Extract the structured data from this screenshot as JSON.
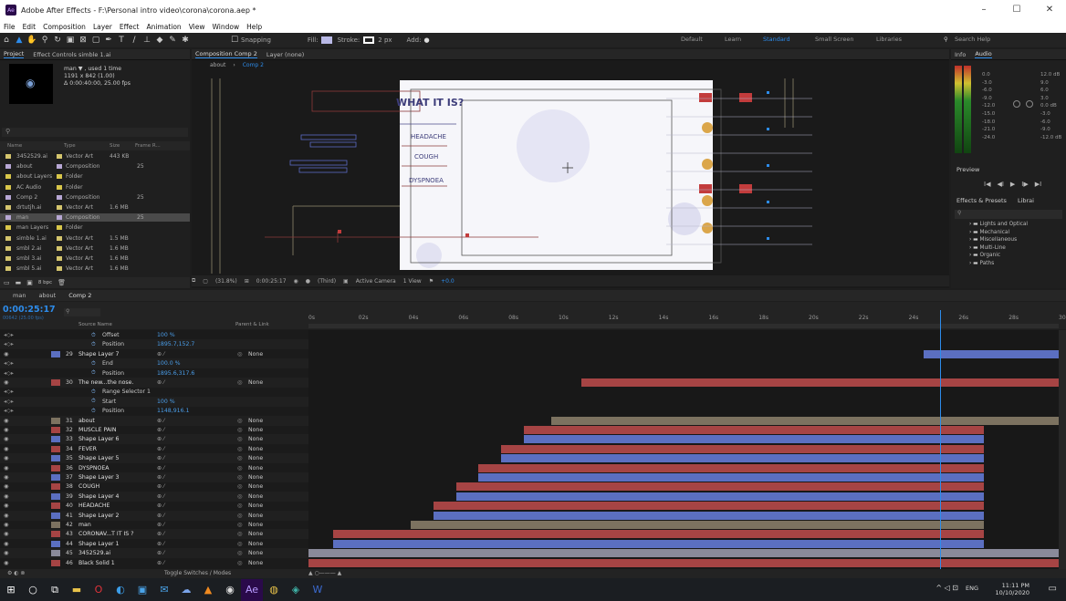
{
  "app": {
    "title": "Adobe After Effects - F:\\Personal intro video\\corona\\corona.aep *",
    "logo": "Ae",
    "window_controls": [
      "–",
      "☐",
      "✕"
    ]
  },
  "menu": [
    "File",
    "Edit",
    "Composition",
    "Layer",
    "Effect",
    "Animation",
    "View",
    "Window",
    "Help"
  ],
  "toolbar": {
    "snapping": "Snapping",
    "fill": "Fill:",
    "stroke": "Stroke:",
    "stroke_px": "2 px",
    "add": "Add:",
    "workspaces": [
      "Default",
      "Learn",
      "Standard",
      "Small Screen",
      "Libraries"
    ],
    "active_workspace": "Standard",
    "search": "Search Help"
  },
  "project": {
    "tabs": [
      "Project",
      "Effect Controls simble 1.ai"
    ],
    "selected_name": "man ▼ , used 1 time",
    "selected_dims": "1191 x 842 (1.00)",
    "selected_dur": "Δ 0:00:40:00, 25.00 fps",
    "cols": [
      "Name",
      "Type",
      "Size",
      "Frame R..."
    ],
    "items": [
      {
        "name": "3452529.ai",
        "type": "Vector Art",
        "size": "443 KB",
        "fr": "",
        "color": "#d4c56d"
      },
      {
        "name": "about",
        "type": "Composition",
        "size": "",
        "fr": "25",
        "color": "#b7a7d4"
      },
      {
        "name": "about Layers",
        "type": "Folder",
        "size": "",
        "fr": "",
        "color": "#d8c64a"
      },
      {
        "name": "AC Audio",
        "type": "Folder",
        "size": "",
        "fr": "",
        "color": "#d8c64a"
      },
      {
        "name": "Comp 2",
        "type": "Composition",
        "size": "",
        "fr": "25",
        "color": "#b7a7d4"
      },
      {
        "name": "drtutjh.ai",
        "type": "Vector Art",
        "size": "1.6 MB",
        "fr": "",
        "color": "#d4c56d"
      },
      {
        "name": "man",
        "type": "Composition",
        "size": "",
        "fr": "25",
        "color": "#b7a7d4"
      },
      {
        "name": "man Layers",
        "type": "Folder",
        "size": "",
        "fr": "",
        "color": "#d8c64a"
      },
      {
        "name": "simble 1.ai",
        "type": "Vector Art",
        "size": "1.5 MB",
        "fr": "",
        "color": "#d4c56d"
      },
      {
        "name": "smbl 2.ai",
        "type": "Vector Art",
        "size": "1.6 MB",
        "fr": "",
        "color": "#d4c56d"
      },
      {
        "name": "smbl 3.ai",
        "type": "Vector Art",
        "size": "1.6 MB",
        "fr": "",
        "color": "#d4c56d"
      },
      {
        "name": "smbl 5.ai",
        "type": "Vector Art",
        "size": "1.6 MB",
        "fr": "",
        "color": "#d4c56d"
      }
    ],
    "bpc": "8 bpc"
  },
  "comp": {
    "tab": "Composition Comp 2",
    "layer_tab": "Layer (none)",
    "crumbs": [
      "about",
      "Comp 2"
    ],
    "texts": [
      "WHAT IT IS?",
      "HEADACHE",
      "COUGH",
      "DYSPNOEA"
    ],
    "zoom": "(31.8%)",
    "time": "0:00:25:17",
    "res": "(Third)",
    "camera": "Active Camera",
    "view": "1 View",
    "offset": "+0.0"
  },
  "info": {
    "tabs": [
      "Info",
      "Audio"
    ],
    "db_left": [
      "0.0",
      "-3.0",
      "-6.0",
      "-9.0",
      "-12.0",
      "-15.0",
      "-18.0",
      "-21.0",
      "-24.0"
    ],
    "db_right": [
      "12.0 dB",
      "9.0",
      "6.0",
      "3.0",
      "0.0 dB",
      "-3.0",
      "-6.0",
      "-9.0",
      "-12.0 dB"
    ],
    "preview": "Preview",
    "preview_btns": [
      "I◀",
      "◀I",
      "▶",
      "I▶",
      "▶I"
    ],
    "effects_tabs": [
      "Effects & Presets",
      "Librai"
    ],
    "presets": [
      "Lights and Optical",
      "Mechanical",
      "Miscellaneous",
      "Multi-Line",
      "Organic",
      "Paths"
    ]
  },
  "timeline": {
    "tabs": [
      "man",
      "about",
      "Comp 2"
    ],
    "time": "0:00:25:17",
    "frames": "00642 (25.00 fps)",
    "cols": [
      "Source Name",
      "Parent & Link"
    ],
    "ruler": [
      "0s",
      "02s",
      "04s",
      "06s",
      "08s",
      "10s",
      "12s",
      "14s",
      "16s",
      "18s",
      "20s",
      "22s",
      "24s",
      "26s",
      "28s",
      "30s"
    ],
    "toggle": "Toggle Switches / Modes",
    "layers": [
      {
        "num": "",
        "name": "Offset",
        "kind": "prop",
        "val": "100 %",
        "parent": "",
        "bar": null
      },
      {
        "num": "",
        "name": "Position",
        "kind": "prop",
        "val": "1895.7,152.7",
        "parent": "",
        "bar": null
      },
      {
        "num": "29",
        "name": "Shape Layer 7",
        "kind": "layer",
        "val": "",
        "parent": "None",
        "color": "#5b6fc1",
        "bar": {
          "start": 24.6,
          "end": 31
        }
      },
      {
        "num": "",
        "name": "End",
        "kind": "prop",
        "val": "100.0 %",
        "parent": "",
        "bar": null
      },
      {
        "num": "",
        "name": "Position",
        "kind": "prop",
        "val": "1895.6,317.6",
        "parent": "",
        "bar": null
      },
      {
        "num": "30",
        "name": "The new...the nose.",
        "kind": "layer",
        "val": "",
        "parent": "None",
        "color": "#a64444",
        "bar": {
          "start": 10.9,
          "end": 31
        }
      },
      {
        "num": "",
        "name": "Range Selector 1",
        "kind": "prop",
        "val": "",
        "parent": "",
        "bar": null
      },
      {
        "num": "",
        "name": "Start",
        "kind": "prop",
        "val": "100 %",
        "parent": "",
        "bar": null
      },
      {
        "num": "",
        "name": "Position",
        "kind": "prop",
        "val": "1148,916.1",
        "parent": "",
        "bar": null
      },
      {
        "num": "31",
        "name": "about",
        "kind": "layer",
        "val": "",
        "parent": "None",
        "color": "#7c7260",
        "bar": {
          "start": 9.7,
          "end": 31
        }
      },
      {
        "num": "32",
        "name": "MUSCLE PAIN",
        "kind": "layer",
        "val": "",
        "parent": "None",
        "color": "#a64444",
        "bar": {
          "start": 8.6,
          "end": 27
        }
      },
      {
        "num": "33",
        "name": "Shape Layer 6",
        "kind": "layer",
        "val": "",
        "parent": "None",
        "color": "#5b6fc1",
        "bar": {
          "start": 8.6,
          "end": 27
        }
      },
      {
        "num": "34",
        "name": "FEVER",
        "kind": "layer",
        "val": "",
        "parent": "None",
        "color": "#a64444",
        "bar": {
          "start": 7.7,
          "end": 27
        }
      },
      {
        "num": "35",
        "name": "Shape Layer 5",
        "kind": "layer",
        "val": "",
        "parent": "None",
        "color": "#5b6fc1",
        "bar": {
          "start": 7.7,
          "end": 27
        }
      },
      {
        "num": "36",
        "name": "DYSPNOEA",
        "kind": "layer",
        "val": "",
        "parent": "None",
        "color": "#a64444",
        "bar": {
          "start": 6.8,
          "end": 27
        }
      },
      {
        "num": "37",
        "name": "Shape Layer 3",
        "kind": "layer",
        "val": "",
        "parent": "None",
        "color": "#5b6fc1",
        "bar": {
          "start": 6.8,
          "end": 27
        }
      },
      {
        "num": "38",
        "name": "COUGH",
        "kind": "layer",
        "val": "",
        "parent": "None",
        "color": "#a64444",
        "bar": {
          "start": 5.9,
          "end": 27
        }
      },
      {
        "num": "39",
        "name": "Shape Layer 4",
        "kind": "layer",
        "val": "",
        "parent": "None",
        "color": "#5b6fc1",
        "bar": {
          "start": 5.9,
          "end": 27
        }
      },
      {
        "num": "40",
        "name": "HEADACHE",
        "kind": "layer",
        "val": "",
        "parent": "None",
        "color": "#a64444",
        "bar": {
          "start": 5.0,
          "end": 27
        }
      },
      {
        "num": "41",
        "name": "Shape Layer 2",
        "kind": "layer",
        "val": "",
        "parent": "None",
        "color": "#5b6fc1",
        "bar": {
          "start": 5.0,
          "end": 27
        }
      },
      {
        "num": "42",
        "name": "man",
        "kind": "layer",
        "val": "",
        "parent": "None",
        "color": "#7c7260",
        "bar": {
          "start": 4.1,
          "end": 27
        }
      },
      {
        "num": "43",
        "name": "CORONAV...T IT IS ?",
        "kind": "layer",
        "val": "",
        "parent": "None",
        "color": "#a64444",
        "bar": {
          "start": 1.0,
          "end": 27
        }
      },
      {
        "num": "44",
        "name": "Shape Layer 1",
        "kind": "layer",
        "val": "",
        "parent": "None",
        "color": "#5b6fc1",
        "bar": {
          "start": 1.0,
          "end": 27
        }
      },
      {
        "num": "45",
        "name": "3452529.ai",
        "kind": "layer",
        "val": "",
        "parent": "None",
        "color": "#8a8a9a",
        "bar": {
          "start": 0.0,
          "end": 31
        }
      },
      {
        "num": "46",
        "name": "Black Solid 1",
        "kind": "layer",
        "val": "",
        "parent": "None",
        "color": "#a64444",
        "bar": {
          "start": 0.0,
          "end": 31
        }
      }
    ]
  },
  "taskbar": {
    "time": "11:11 PM",
    "date": "10/10/2020",
    "lang": "ENG"
  }
}
